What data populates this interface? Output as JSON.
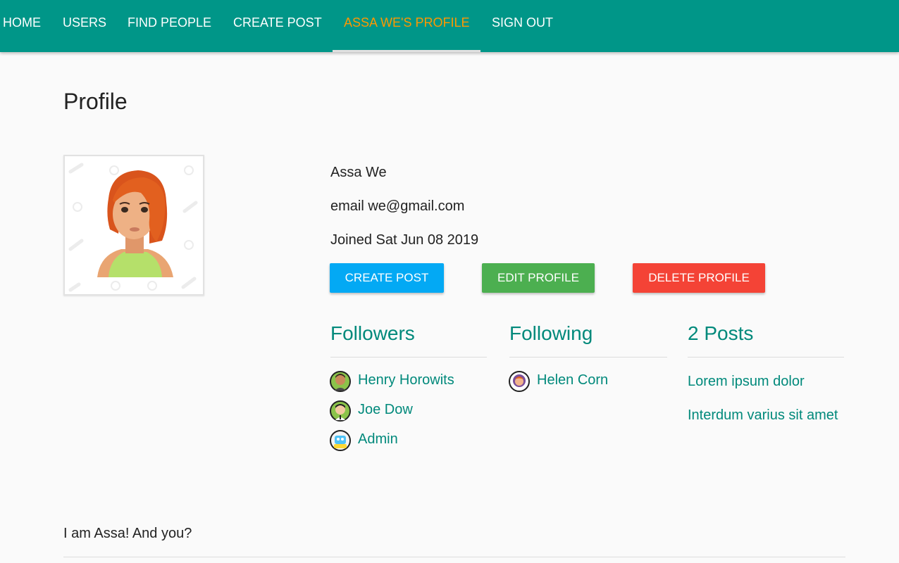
{
  "nav": {
    "items": [
      {
        "label": "HOME",
        "active": false
      },
      {
        "label": "USERS",
        "active": false
      },
      {
        "label": "FIND PEOPLE",
        "active": false
      },
      {
        "label": "CREATE POST",
        "active": false
      },
      {
        "label": "ASSA WE'S PROFILE",
        "active": true
      },
      {
        "label": "SIGN OUT",
        "active": false
      }
    ]
  },
  "profile": {
    "title": "Profile",
    "avatar_icon": "woman-avatar-icon",
    "name": "Assa We",
    "email": "email we@gmail.com",
    "joined": "Joined Sat Jun 08 2019",
    "bio": "I am Assa! And you?"
  },
  "actions": {
    "create_post": "CREATE POST",
    "edit_profile": "EDIT PROFILE",
    "delete_profile": "DELETE PROFILE"
  },
  "followers": {
    "heading": "Followers",
    "people": [
      {
        "name": "Henry Horowits",
        "icon": "bearded-man-avatar-icon"
      },
      {
        "name": "Joe Dow",
        "icon": "man-avatar-icon"
      },
      {
        "name": "Admin",
        "icon": "robot-avatar-icon"
      }
    ]
  },
  "following": {
    "heading": "Following",
    "people": [
      {
        "name": "Helen Corn",
        "icon": "woman-avatar-icon"
      }
    ]
  },
  "posts": {
    "heading": "2 Posts",
    "items": [
      {
        "title": "Lorem ipsum dolor"
      },
      {
        "title": "Interdum varius sit amet"
      }
    ]
  },
  "colors": {
    "nav_bg": "#009688",
    "nav_active": "#ff9800",
    "accent_text": "#00897b",
    "create_btn": "#03a9f4",
    "edit_btn": "#4caf50",
    "delete_btn": "#f44336"
  }
}
